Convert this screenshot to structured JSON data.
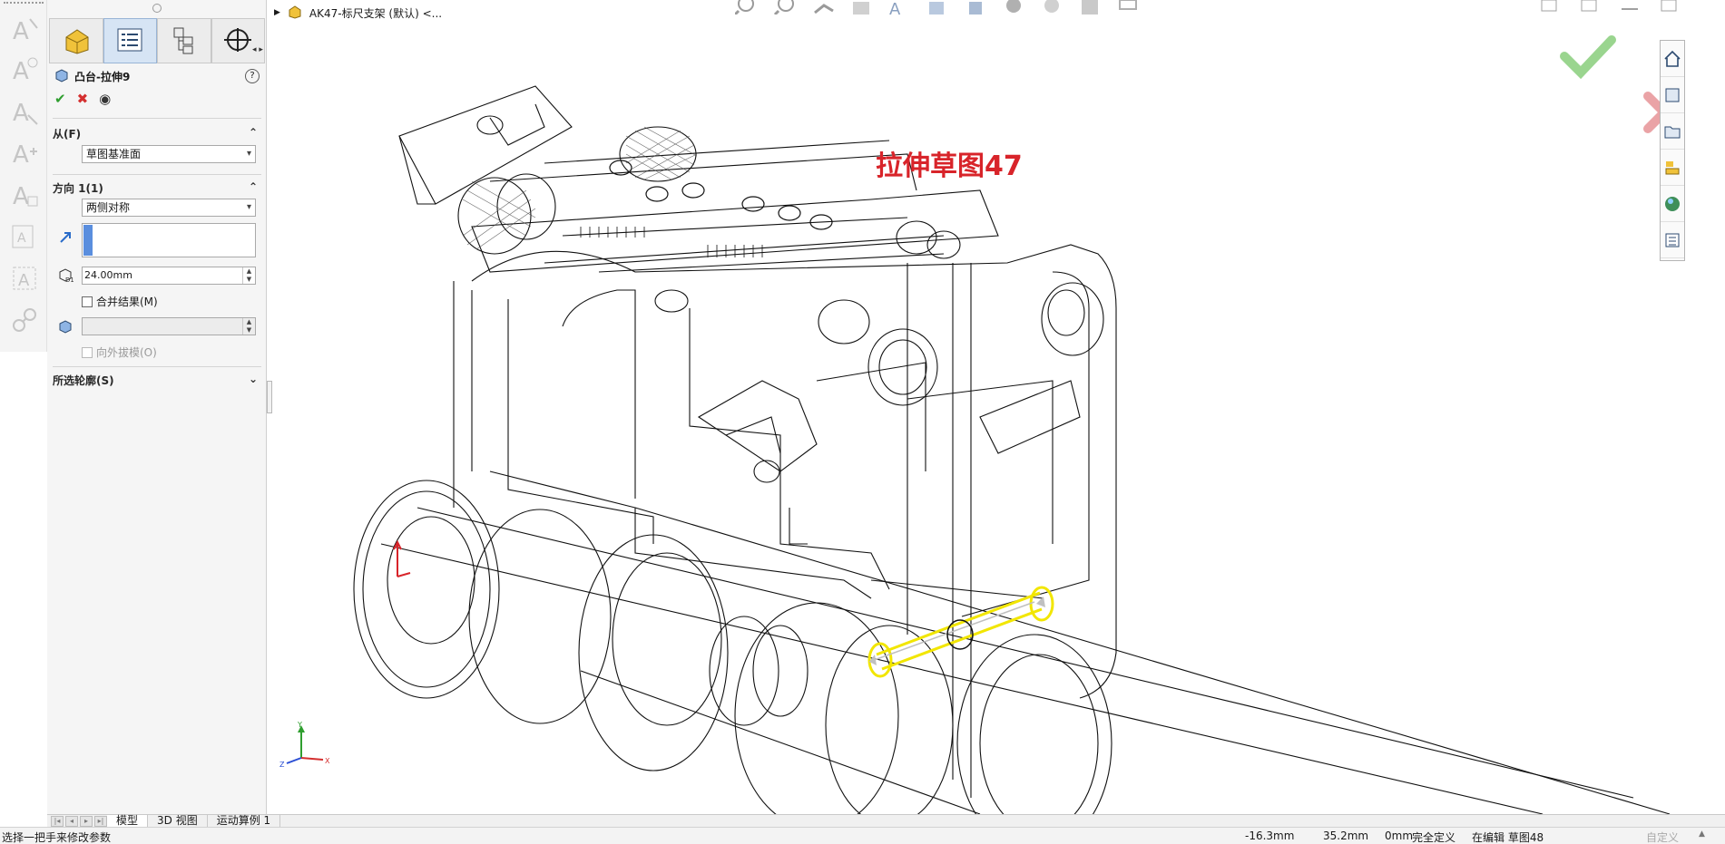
{
  "breadcrumb": {
    "title": "AK47-标尺支架 (默认) <..."
  },
  "property_manager": {
    "title": "凸台-拉伸9",
    "help": "?",
    "from": {
      "label": "从(F)",
      "value": "草图基准面"
    },
    "direction1": {
      "label": "方向 1(1)",
      "end_condition": "两侧对称",
      "depth": "24.00mm",
      "merge_result": "合并结果(M)",
      "draft_outward": "向外拔模(O)"
    },
    "selected_contours": {
      "label": "所选轮廓(S)"
    }
  },
  "viewport": {
    "sketch_label": "拉伸草图47"
  },
  "bottom_tabs": [
    {
      "label": "模型",
      "active": true
    },
    {
      "label": "3D 视图",
      "active": false
    },
    {
      "label": "运动算例 1",
      "active": false
    }
  ],
  "status_bar": {
    "hint": "选择一把手来修改参数",
    "x": "-16.3mm",
    "y": "35.2mm",
    "z": "0mm",
    "definition": "完全定义",
    "editing": "在编辑 草图48",
    "custom": "自定义"
  },
  "icons": {
    "tabs": [
      "feature-manager-icon",
      "property-manager-icon",
      "configuration-manager-icon",
      "dimxpert-icon"
    ],
    "colors": {
      "accent_blue": "#5a8ede",
      "ok_green": "#2f9e2f",
      "cancel_red": "#d42f2f",
      "sketch_label": "#d8242a",
      "highlight_yellow": "#f2e600"
    }
  }
}
